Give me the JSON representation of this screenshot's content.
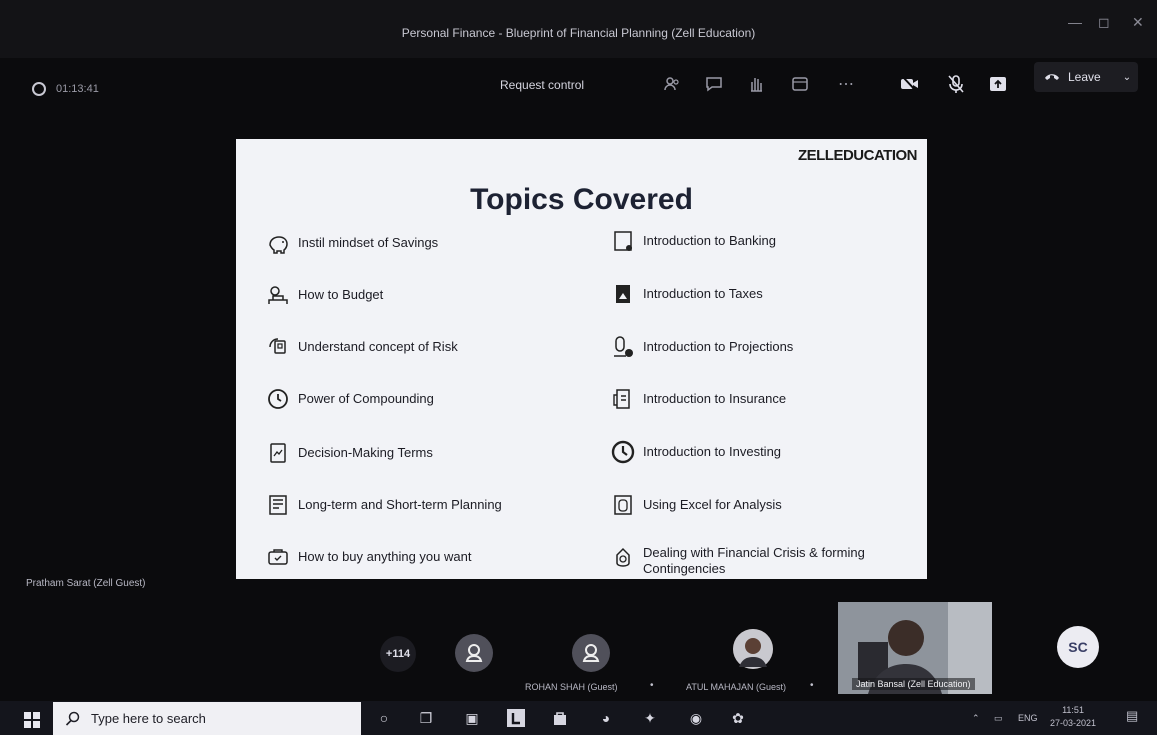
{
  "window": {
    "title": "Personal Finance - Blueprint of Financial Planning (Zell Education)",
    "controls": [
      "minimize-icon",
      "maximize-icon",
      "close-icon"
    ]
  },
  "toolbar": {
    "timer": "01:13:41",
    "request_control_label": "Request control",
    "icons": [
      "people-icon",
      "chat-icon",
      "raise-hand-icon",
      "rooms-icon",
      "more-icon",
      "camera-off-icon",
      "mic-off-icon",
      "share-icon"
    ],
    "leave_label": "Leave"
  },
  "slide": {
    "brand": "ZELLEDUCATION",
    "title": "Topics Covered",
    "left_topics": [
      {
        "label": "Instil mindset of Savings",
        "icon": "piggy-bank-icon"
      },
      {
        "label": "How to Budget",
        "icon": "budget-icon"
      },
      {
        "label": "Understand concept of Risk",
        "icon": "risk-icon"
      },
      {
        "label": "Power of Compounding",
        "icon": "clock-icon"
      },
      {
        "label": "Decision-Making Terms",
        "icon": "document-chart-icon"
      },
      {
        "label": "Long-term and Short-term Planning",
        "icon": "planning-icon"
      },
      {
        "label": "How to buy anything you want",
        "icon": "shopping-icon"
      }
    ],
    "right_topics": [
      {
        "label": "Introduction to Banking",
        "icon": "bank-icon"
      },
      {
        "label": "Introduction to Taxes",
        "icon": "tax-icon"
      },
      {
        "label": "Introduction to Projections",
        "icon": "projection-icon"
      },
      {
        "label": "Introduction to Insurance",
        "icon": "insurance-icon"
      },
      {
        "label": "Introduction to Investing",
        "icon": "clock-icon"
      },
      {
        "label": "Using Excel for Analysis",
        "icon": "excel-icon"
      },
      {
        "label": "Dealing with Financial Crisis & forming Contingencies",
        "icon": "crisis-icon"
      }
    ]
  },
  "presenter_label": "Pratham Sarat (Zell Guest)",
  "participants": {
    "more_count": "+114",
    "names": [
      "ROHAN SHAH (Guest)",
      "ATUL MAHAJAN (Guest)",
      "Jatin Bansal (Zell Education)"
    ],
    "initials": "SC"
  },
  "taskbar": {
    "search_placeholder": "Type here to search",
    "language": "ENG",
    "time": "11:51",
    "date": "27-03-2021"
  }
}
